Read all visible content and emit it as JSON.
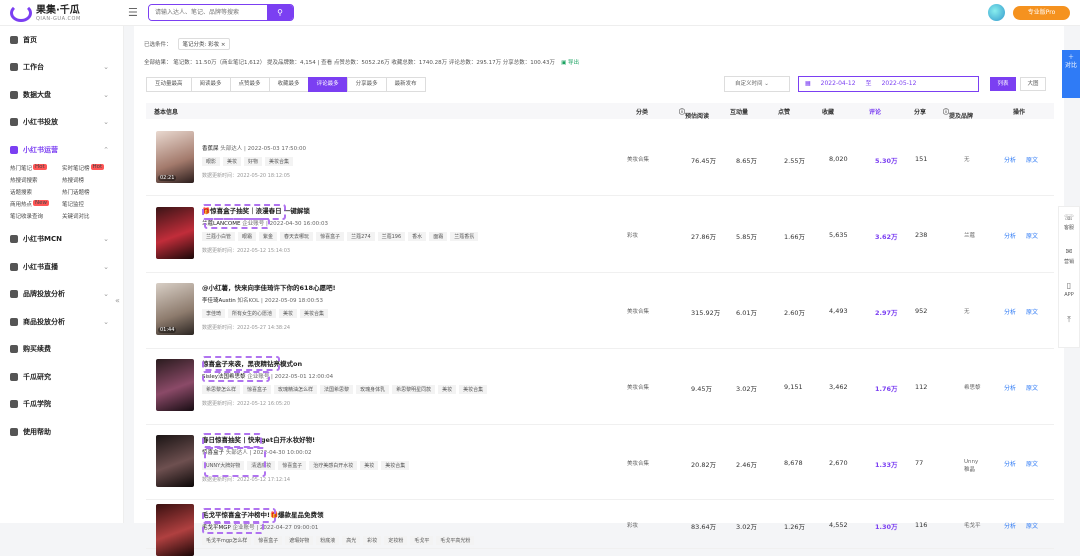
{
  "brand": {
    "name": "果集·千瓜",
    "sub": "QIAN-GUA.COM"
  },
  "header": {
    "search_placeholder": "请输入达人、笔记、品牌等搜索",
    "pro_label": "专业版Pro"
  },
  "sidebar": {
    "items": [
      {
        "label": "首页"
      },
      {
        "label": "工作台"
      },
      {
        "label": "数据大盘"
      },
      {
        "label": "小红书投放"
      },
      {
        "label": "小红书运营"
      },
      {
        "label": "小红书MCN"
      },
      {
        "label": "小红书直播"
      },
      {
        "label": "品牌投放分析"
      },
      {
        "label": "商品投放分析"
      },
      {
        "label": "购买续费"
      },
      {
        "label": "千瓜研究"
      },
      {
        "label": "千瓜学院"
      },
      {
        "label": "使用帮助"
      }
    ],
    "sub": [
      "热门笔记",
      "实时笔记榜",
      "热搜词搜索",
      "热搜词榜",
      "话题搜索",
      "热门话题榜",
      "商用热点",
      "笔记监控",
      "笔记收录查询",
      "关键词对比"
    ]
  },
  "filters": {
    "selected_label": "已选条件：",
    "selected_chip": "笔记分类: 彩妆 ×",
    "stats": "全部结果：  笔记数：11.50万（商业笔记1,612）  提及品牌数：4,154 | 查看  点赞总数：5052.26万  收藏总数：1740.28万  评论总数：295.17万  分享总数：100.43万",
    "export": "导出"
  },
  "tabs": [
    "互动量最高",
    "阅读最多",
    "点赞最多",
    "收藏最多",
    "评论最多",
    "分享最多",
    "最新发布"
  ],
  "time_select": "自定义时间",
  "date_range": {
    "start": "2022-04-12",
    "sep": "至",
    "end": "2022-05-12"
  },
  "view": {
    "list": "列表",
    "grid": "大图"
  },
  "columns": {
    "info": "基本信息",
    "category": "分类",
    "reads": "预估阅读",
    "interact": "互动量",
    "likes": "点赞",
    "favs": "收藏",
    "comments": "评论",
    "shares": "分享",
    "brands": "提及品牌",
    "ops": "操作"
  },
  "rows": [
    {
      "title": "",
      "author": "香蕉屎",
      "author_meta": "头部达人 | 2022-05-03 17:50:00",
      "tags": [
        "眼影",
        "美妆",
        "好物",
        "美妆合集"
      ],
      "updated": "数据更新时间：2022-05-20 18:12:05",
      "duration": "02:21",
      "category": "美妆合集",
      "reads": "76.45万",
      "interact": "8.65万",
      "likes": "2.55万",
      "favs": "8,020",
      "comments": "5.30万",
      "shares": "151",
      "brands": "无",
      "op1": "分析",
      "op2": "原文"
    },
    {
      "title": "🎁惊喜盒子抽奖｜浪漫春日 一键解锁",
      "author": "兰蔻LANCOME",
      "author_meta": "企业账号 | 2022-04-30 16:00:03",
      "tags": [
        "兰蔻小白管",
        "眼霜",
        "紫金",
        "春天去哪玩",
        "惊喜盒子",
        "兰蔻274",
        "兰蔻196",
        "香水",
        "面霜",
        "兰蔻香氛"
      ],
      "updated": "数据更新时间：2022-05-12 15:14:03",
      "duration": "",
      "category": "彩妆",
      "reads": "27.86万",
      "interact": "5.85万",
      "likes": "1.66万",
      "favs": "5,635",
      "comments": "3.62万",
      "shares": "238",
      "brands": "兰蔻",
      "op1": "分析",
      "op2": "原文"
    },
    {
      "title": "@小红薯，快来向李佳琦许下你的618心愿吧!",
      "author": "李佳琦Austin",
      "author_meta": "知名KOL | 2022-05-09 18:00:53",
      "tags": [
        "李佳琦",
        "所有女生的心愿池",
        "美妆",
        "美妆合集"
      ],
      "updated": "数据更新时间：2022-05-27 14:38:24",
      "duration": "01:44",
      "category": "美妆合集",
      "reads": "315.92万",
      "interact": "6.01万",
      "likes": "2.60万",
      "favs": "4,493",
      "comments": "2.97万",
      "shares": "952",
      "brands": "无",
      "op1": "分析",
      "op2": "原文"
    },
    {
      "title": "惊喜盒子来袭，黑夜精钻亮模式on",
      "author": "Sisley法国希思黎",
      "author_meta": "企业账号 | 2022-05-01 12:00:04",
      "tags": [
        "希思黎怎么样",
        "惊喜盒子",
        "玫瑰精油怎么样",
        "法国希思黎",
        "玫瑰身体乳",
        "希思黎明星同款",
        "美妆",
        "美妆合集"
      ],
      "updated": "数据更新时间：2022-05-12 16:05:20",
      "duration": "",
      "category": "美妆合集",
      "reads": "9.45万",
      "interact": "3.02万",
      "likes": "9,151",
      "favs": "3,462",
      "comments": "1.76万",
      "shares": "112",
      "brands": "希思黎",
      "op1": "分析",
      "op2": "原文"
    },
    {
      "title": "春日惊喜抽奖 | 快来get白开水妆好物!",
      "author": "惊喜盒子",
      "author_meta": "头部达人 | 2022-04-30 10:00:02",
      "tags": [
        "UNNY大牌好物",
        "清透底妆",
        "惊喜盒子",
        "治疗美感白开水妆",
        "美妆",
        "美妆合集"
      ],
      "updated": "数据更新时间：2022-05-12 17:12:14",
      "duration": "",
      "category": "美妆合集",
      "reads": "20.82万",
      "interact": "2.46万",
      "likes": "8,678",
      "favs": "2,670",
      "comments": "1.33万",
      "shares": "77",
      "brands": "Unny\n稚晶",
      "op1": "分析",
      "op2": "原文"
    },
    {
      "title": "毛戈平惊喜盒子冲榜中!🎁爆款星品免费领",
      "author": "毛戈平MGP",
      "author_meta": "企业账号 | 2022-04-27 09:00:01",
      "tags": [
        "毛戈平mgp怎么样",
        "惊喜盒子",
        "遮瑕好物",
        "粉底液",
        "高光",
        "彩妆",
        "定妆粉",
        "毛戈平",
        "毛戈平高光粉"
      ],
      "updated": "",
      "duration": "",
      "category": "彩妆",
      "reads": "83.64万",
      "interact": "3.02万",
      "likes": "1.26万",
      "favs": "4,552",
      "comments": "1.30万",
      "shares": "116",
      "brands": "毛戈平",
      "op1": "分析",
      "op2": "原文"
    }
  ],
  "rail": {
    "compare": "对比",
    "service": "客服",
    "marketing": "营销",
    "app": "APP"
  }
}
